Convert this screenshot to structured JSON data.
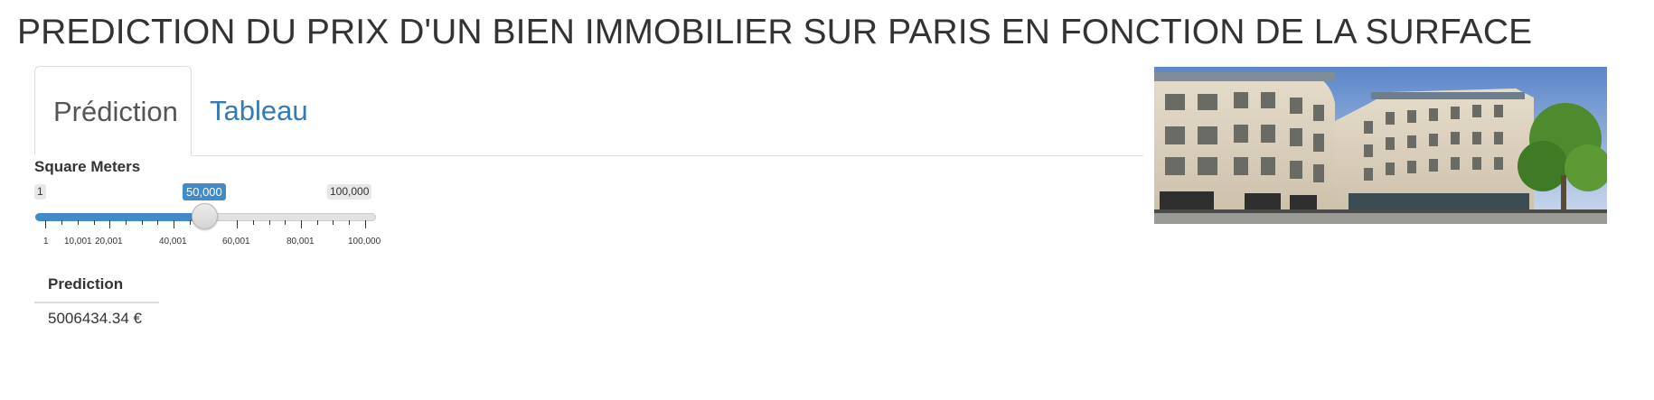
{
  "page": {
    "title": "PREDICTION DU PRIX D'UN BIEN IMMOBILIER SUR PARIS EN FONCTION DE LA SURFACE"
  },
  "tabs": [
    {
      "label": "Prédiction",
      "active": true
    },
    {
      "label": "Tableau",
      "active": false
    }
  ],
  "slider": {
    "label": "Square Meters",
    "min_label": "1",
    "max_label": "100,000",
    "value_label": "50,000",
    "min": 1,
    "max": 100000,
    "value": 50000,
    "tick_labels": [
      "1",
      "10,001",
      "20,001",
      "40,001",
      "60,001",
      "80,001",
      "100,000"
    ]
  },
  "prediction": {
    "header": "Prediction",
    "value": "5006434.34 €"
  },
  "colors": {
    "accent": "#428bca",
    "link": "#337ab7",
    "text": "#333333"
  },
  "image": {
    "description_icon": "paris-buildings-photo"
  }
}
